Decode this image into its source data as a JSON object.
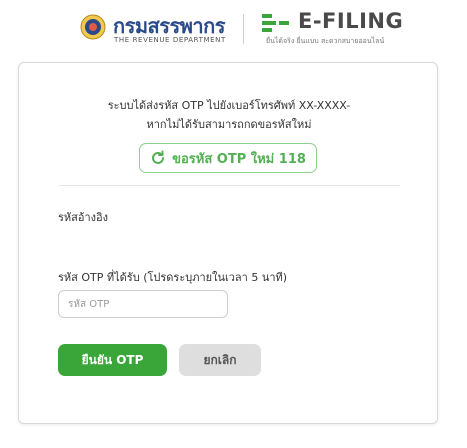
{
  "header": {
    "rd_name": "กรมสรรพากร",
    "rd_subtitle": "THE REVENUE DEPARTMENT",
    "efiling_name": "E-FILING",
    "efiling_subtitle": "ยื่นได้จริง ยื่นแบบ สะดวกสบายออนไลน์"
  },
  "card": {
    "message_line1": "ระบบได้ส่งรหัส OTP ไปยังเบอร์โทรศัพท์ XX-XXXX-",
    "message_line2": "หากไม่ได้รับสามารถกดขอรหัสใหม่",
    "resend_label": "ขอรหัส OTP ใหม่ 118",
    "reference_label": "รหัสอ้างอิง",
    "otp_label": "รหัส OTP ที่ได้รับ (โปรดระบุภายในเวลา 5 นาที)",
    "otp_placeholder": "รหัส OTP",
    "otp_value": "",
    "confirm_label": "ยืนยัน OTP",
    "cancel_label": "ยกเลิก"
  },
  "colors": {
    "brand_blue": "#2a4a8a",
    "primary_green": "#3aa63a",
    "outline_green": "#8fd08f",
    "cancel_gray": "#dedede"
  },
  "icons": {
    "rd_logo": "revenue-department-seal",
    "efiling_logo": "efiling-logo",
    "resend": "refresh-icon"
  }
}
